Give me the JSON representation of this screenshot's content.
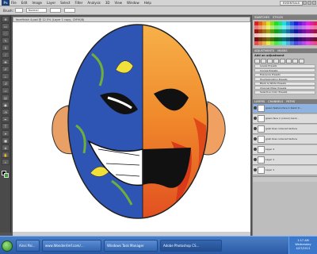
{
  "menubar": {
    "logo": "Ps",
    "items": [
      "File",
      "Edit",
      "Image",
      "Layer",
      "Select",
      "Filter",
      "Analysis",
      "3D",
      "View",
      "Window",
      "Help"
    ],
    "workspace": "ESSENTIALS"
  },
  "options": {
    "brush_label": "Brush:",
    "mode_value": "Normal"
  },
  "document": {
    "tab_title": "facefinish 4.psd @ 12.5% (Layer 1 copy, CMYK/8)"
  },
  "panels": {
    "top_tabs": [
      "SWATCHES",
      "STYLES"
    ],
    "adjust_tabs": [
      "ADJUSTMENTS",
      "MASKS"
    ],
    "adjust_title": "Add an adjustment",
    "presets": [
      "Levels Presets",
      "Curves Presets",
      "Exposure Presets",
      "Hue/Saturation Presets",
      "Black & White Presets",
      "Channel Mixer Presets",
      "Selective Color Presets"
    ],
    "layers_tabs": [
      "LAYERS",
      "CHANNELS",
      "PATHS"
    ],
    "layers": [
      "green feature face 1 blank tr...",
      "green face 1 (colour) back...",
      "grab blue coloured texture",
      "grab blue coloured texture",
      "Layer 2",
      "Layer 1",
      "Layer 1"
    ]
  },
  "taskbar": {
    "buttons": [
      "Ainsi Pai...",
      "www.Wonder4mf.com/...",
      "Windows Task Manager",
      "Adobe Photoshop CS..."
    ],
    "time": "1:17 AM",
    "day": "Wednesday",
    "date": "4/27/2011"
  }
}
